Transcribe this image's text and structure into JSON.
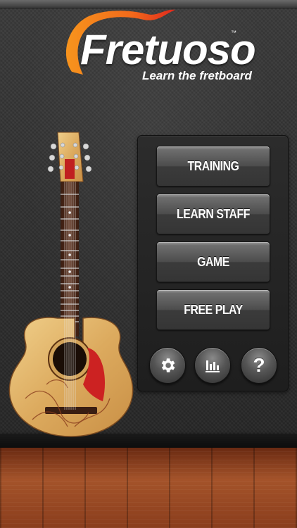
{
  "app": {
    "logo_text": "Fretuoso",
    "trademark": "™",
    "tagline": "Learn the fretboard"
  },
  "guitar": {
    "headstock_label": "ntuoso"
  },
  "menu": {
    "items": [
      {
        "label": "TRAINING"
      },
      {
        "label": "LEARN STAFF"
      },
      {
        "label": "GAME"
      },
      {
        "label": "FREE PLAY"
      }
    ],
    "icon_buttons": [
      {
        "icon": "gear-icon"
      },
      {
        "icon": "bar-chart-icon"
      },
      {
        "icon": "help-icon",
        "glyph": "?"
      }
    ]
  },
  "colors": {
    "logo_swoosh": "#f26a1b",
    "logo_swoosh_dark": "#e0281c",
    "pickguard": "#cc2222",
    "guitar_wood": "#e3b46a"
  }
}
